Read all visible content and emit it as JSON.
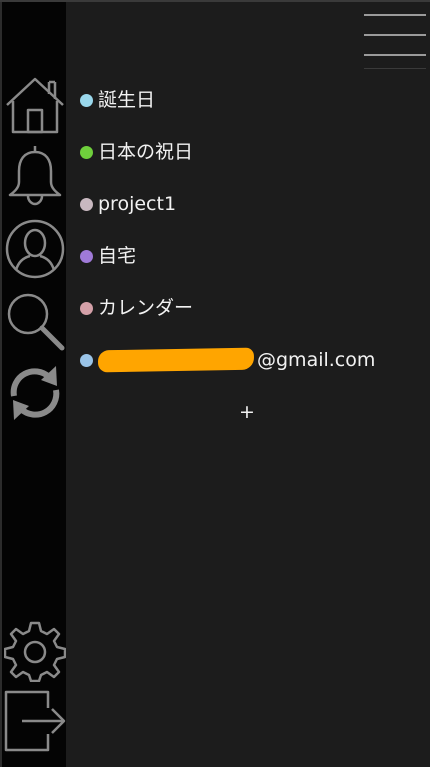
{
  "calendars": [
    {
      "label": "誕生日",
      "color": "#9ad8ec",
      "redacted": false
    },
    {
      "label": "日本の祝日",
      "color": "#6fcf3c",
      "redacted": false
    },
    {
      "label": "project1",
      "color": "#c8b8c0",
      "redacted": false
    },
    {
      "label": "自宅",
      "color": "#a07ad8",
      "redacted": false
    },
    {
      "label": "カレンダー",
      "color": "#d4a0a8",
      "redacted": false
    },
    {
      "label": "@gmail.com",
      "color": "#9ac4e8",
      "redacted": true
    }
  ],
  "add_label": "+",
  "sidebar": {
    "icons": [
      "home-icon",
      "bell-icon",
      "profile-icon",
      "search-icon",
      "sync-icon",
      "gear-icon",
      "logout-icon"
    ]
  },
  "colors": {
    "redaction": "#ffa500",
    "panel_bg": "#1c1c1c",
    "rail_bg": "#040404",
    "icon_stroke": "#8a8a8a"
  }
}
